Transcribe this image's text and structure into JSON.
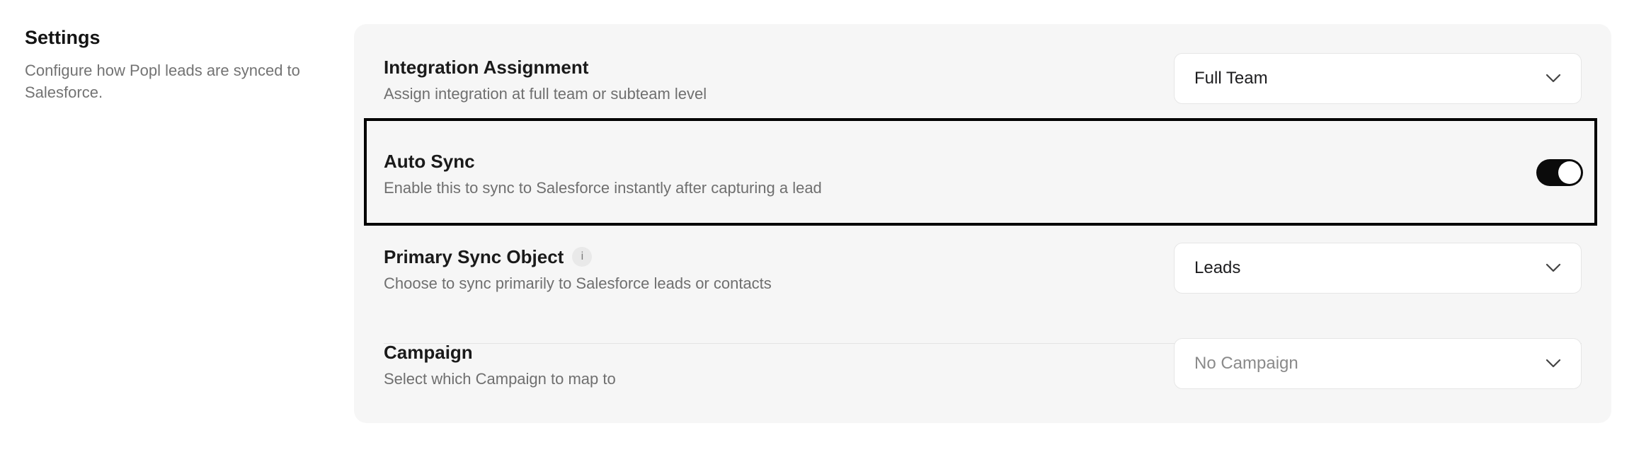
{
  "intro": {
    "title": "Settings",
    "description": "Configure how Popl leads are synced to Salesforce."
  },
  "settings": {
    "integration": {
      "title": "Integration Assignment",
      "description": "Assign integration at full team or subteam level",
      "value": "Full Team",
      "icon": "chevron-down-icon"
    },
    "auto_sync": {
      "title": "Auto Sync",
      "description": "Enable this to sync to Salesforce instantly after capturing a lead",
      "enabled": true,
      "highlighted": true
    },
    "primary_sync": {
      "title": "Primary Sync Object",
      "info_glyph": "i",
      "description": "Choose to sync primarily to Salesforce leads or contacts",
      "value": "Leads",
      "icon": "chevron-down-icon"
    },
    "campaign": {
      "title": "Campaign",
      "description": "Select which Campaign to map to",
      "placeholder": "No Campaign",
      "icon": "chevron-down-icon"
    }
  },
  "colors": {
    "card_bg": "#f6f6f6",
    "toggle_on": "#0b0b0b",
    "highlight_border": "#000000",
    "muted_text": "#6f6f6f"
  }
}
